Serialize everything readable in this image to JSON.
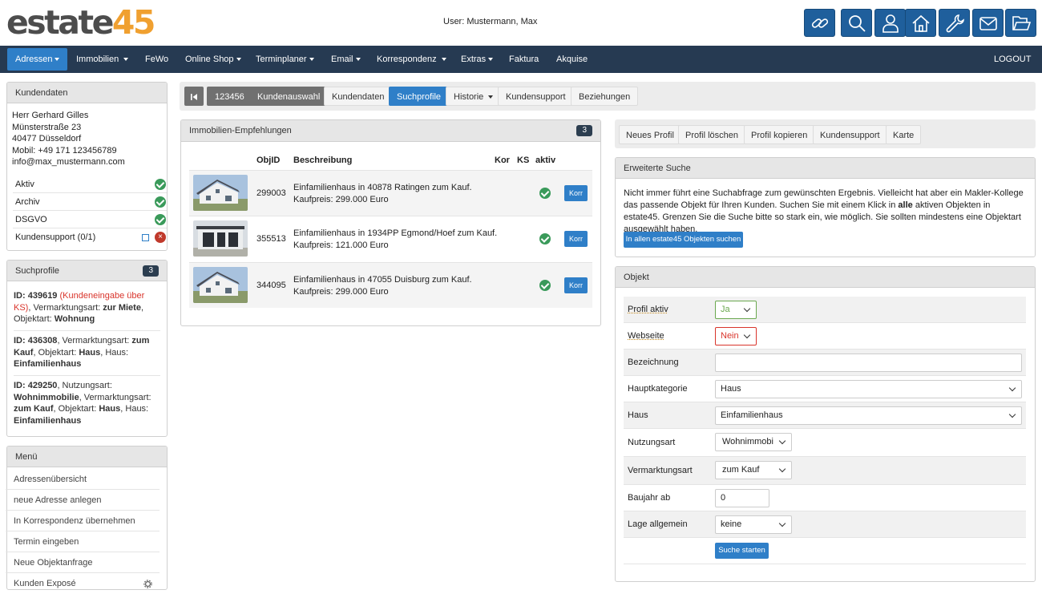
{
  "header": {
    "logo_part1": "estate",
    "logo_part2": "45",
    "user_label": "User: Mustermann, Max",
    "tools": [
      "link-icon",
      "search-icon",
      "user-icon",
      "home-icon",
      "wrench-icon",
      "mail-icon",
      "folder-icon"
    ],
    "accent_color": "#1f5f9c"
  },
  "nav": {
    "items": [
      {
        "label": "Adressen"
      },
      {
        "label": "Immobilien"
      },
      {
        "label": "FeWo"
      },
      {
        "label": "Online Shop"
      },
      {
        "label": "Terminplaner"
      },
      {
        "label": "Email"
      },
      {
        "label": "Korrespondenz"
      },
      {
        "label": "Extras"
      },
      {
        "label": "Faktura"
      },
      {
        "label": "Akquise"
      }
    ],
    "logout": "LOGOUT",
    "active": "Adressen"
  },
  "customer": {
    "title": "Kundendaten",
    "lines": [
      "Herr Gerhard Gilles",
      "Münsterstraße 23",
      "40477 Düsseldorf",
      "Mobil: +49 171 123456789",
      "info@max_mustermann.com"
    ],
    "status": [
      {
        "label": "Aktiv"
      },
      {
        "label": "Archiv"
      },
      {
        "label": "DSGVO"
      },
      {
        "label": "Kundensupport (0/1)"
      }
    ]
  },
  "suchprofile": {
    "title": "Suchprofile",
    "count": "3",
    "items": [
      {
        "id": "ID: 439619",
        "note": "(Kundeneingabe über KS)",
        "t1": ", Vermarktungsart: ",
        "b1": "zur Miete",
        "t2": ", Objektart: ",
        "b2": "Wohnung"
      },
      {
        "id": "ID: 436308",
        "t1": ", Vermarktungsart: ",
        "b1": "zum Kauf",
        "t2": ", Objektart: ",
        "b2": "Haus",
        "t3": ", Haus: ",
        "b3": "Einfamilienhaus"
      },
      {
        "id": "ID: 429250",
        "t1": ", Nutzungsart: ",
        "b1": "Wohnimmobilie",
        "t2": ", Vermarktungsart: ",
        "b2": "zum Kauf",
        "t3": ", Objektart: ",
        "b3": "Haus",
        "t4": ", Haus: ",
        "b4": "Einfamilienhaus"
      }
    ]
  },
  "menu": {
    "title": "Menü",
    "items": [
      "Adressenübersicht",
      "neue Adresse anlegen",
      "In Korrespondenz übernehmen",
      "Termin eingeben",
      "Neue Objektanfrage",
      "Kunden Exposé"
    ]
  },
  "tabs": {
    "first_icon": "first-page-icon",
    "items": [
      "123456",
      "Kundenauswahl",
      "Kundendaten",
      "Suchprofile",
      "Historie",
      "Kundensupport",
      "Beziehungen"
    ],
    "active": "Suchprofile"
  },
  "recommendations": {
    "title": "Immobilien-Empfehlungen",
    "count": "3",
    "headers": {
      "objid": "ObjID",
      "beschreibung": "Beschreibung",
      "kor": "Kor",
      "ks": "KS",
      "aktiv": "aktiv"
    },
    "rows": [
      {
        "objid": "299003",
        "desc1": "Einfamilienhaus in 40878 Ratingen zum Kauf.",
        "desc2": "Kaufpreis: 299.000 Euro",
        "btn": "Korr"
      },
      {
        "objid": "355513",
        "desc1": "Einfamilienhaus in 1934PP Egmond/Hoef zum Kauf.",
        "desc2": "Kaufpreis: 121.000 Euro",
        "btn": "Korr"
      },
      {
        "objid": "344095",
        "desc1": "Einfamilienhaus in 47055 Duisburg zum Kauf.",
        "desc2": "Kaufpreis: 299.000 Euro",
        "btn": "Korr"
      }
    ]
  },
  "profile_actions": [
    "Neues Profil",
    "Profil löschen",
    "Profil kopieren",
    "Kundensupport",
    "Karte"
  ],
  "extended_search": {
    "title": "Erweiterte Suche",
    "text1": "Nicht immer führt eine Suchabfrage zum gewünschten Ergebnis. Vielleicht hat aber ein Makler-Kollege das passende Objekt für Ihren Kunden. Suchen Sie mit einem Klick in ",
    "bold": "alle",
    "text2": " aktiven Objekten in estate45. Grenzen Sie die Suche bitte so stark ein, wie möglich. Sie sollten mindestens eine Objektart ausgewählt haben.",
    "button": "In allen estate45 Objekten suchen"
  },
  "objekt": {
    "title": "Objekt",
    "fields": {
      "profil_aktiv": {
        "label": "Profil aktiv",
        "value": "Ja"
      },
      "webseite": {
        "label": "Webseite",
        "value": "Nein"
      },
      "bezeichnung": {
        "label": "Bezeichnung",
        "value": ""
      },
      "hauptkategorie": {
        "label": "Hauptkategorie",
        "value": "Haus"
      },
      "haus": {
        "label": "Haus",
        "value": "Einfamilienhaus"
      },
      "nutzungsart": {
        "label": "Nutzungsart",
        "value": "Wohnimmobi"
      },
      "vermarktungsart": {
        "label": "Vermarktungsart",
        "value": "zum Kauf"
      },
      "baujahr": {
        "label": "Baujahr ab",
        "value": "0"
      },
      "lage": {
        "label": "Lage allgemein",
        "value": "keine"
      }
    },
    "search_button": "Suche starten"
  }
}
